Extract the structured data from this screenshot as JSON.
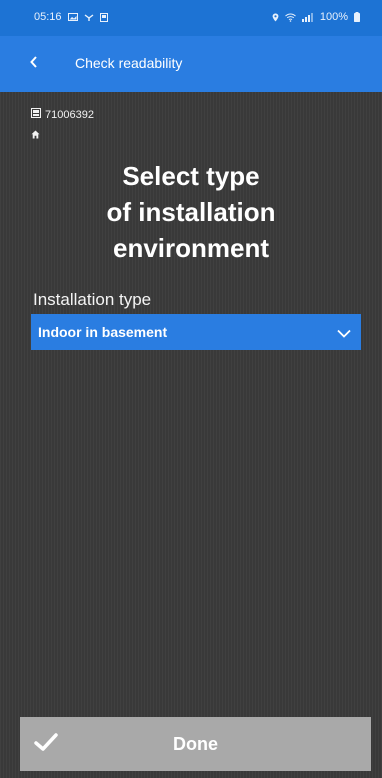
{
  "status_bar": {
    "time": "05:16",
    "battery": "100%",
    "icons": [
      "gallery-icon",
      "network-icon",
      "notification-icon",
      "location-icon",
      "wifi-icon",
      "signal-icon",
      "battery-icon"
    ]
  },
  "app_bar": {
    "back_icon": "chevron-left-icon",
    "title": "Check readability"
  },
  "meter": {
    "id": "71006392",
    "meter_icon": "meter-icon",
    "home_icon": "home-icon"
  },
  "heading": {
    "lines": [
      "Select type",
      "of installation",
      "environment"
    ]
  },
  "installation": {
    "label": "Installation type",
    "selected": "Indoor in basement",
    "dropdown_icon": "chevron-down-icon"
  },
  "done_button": {
    "label": "Done",
    "icon": "check-icon"
  },
  "colors": {
    "status_bar": "#1d73d4",
    "app_bar": "#2a7de1",
    "background": "#393939",
    "select": "#2a7de1",
    "done_button": "#a9a9a9"
  }
}
